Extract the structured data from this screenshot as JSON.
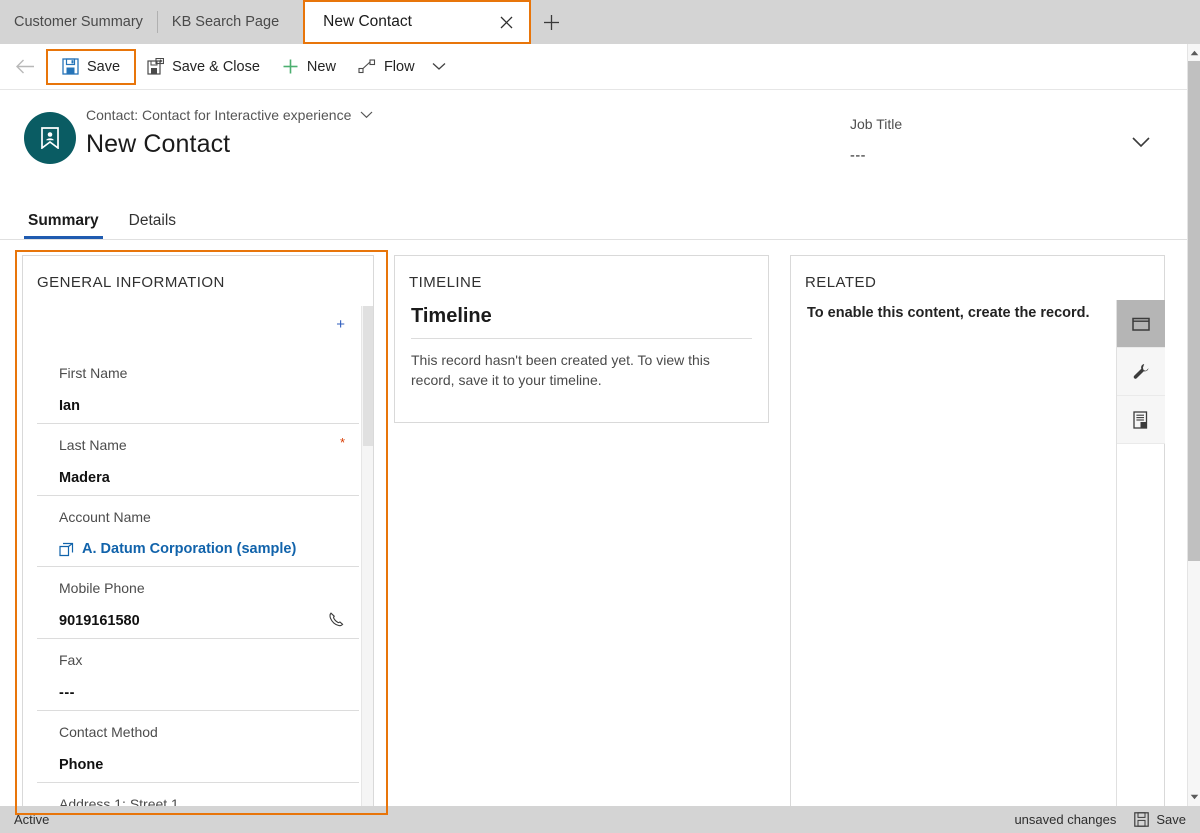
{
  "tabstrip": {
    "tabs": [
      {
        "label": "Customer Summary",
        "active": false
      },
      {
        "label": "KB Search Page",
        "active": false
      }
    ],
    "active_tab": {
      "label": "New Contact",
      "close_icon": "close-icon"
    },
    "new_tab_icon": "plus-icon",
    "highlight_color": "#e8750a"
  },
  "commandbar": {
    "back_icon": "back-arrow-icon",
    "commands": [
      {
        "label": "Save",
        "icon": "save-floppy-icon",
        "highlighted": true
      },
      {
        "label": "Save & Close",
        "icon": "save-and-close-icon",
        "highlighted": false
      },
      {
        "label": "New",
        "icon": "plus-icon",
        "highlighted": false
      },
      {
        "label": "Flow",
        "icon": "flow-icon",
        "highlighted": false
      }
    ],
    "overflow_icon": "chevron-down-icon"
  },
  "record_header": {
    "avatar_icon": "contact-card-icon",
    "avatar_color": "#0a5c63",
    "subtitle": "Contact: Contact for Interactive experience",
    "subtitle_chevron": "chevron-down-icon",
    "name": "New Contact",
    "header_field": {
      "label": "Job Title",
      "value": "---"
    },
    "expand_icon": "chevron-down-icon"
  },
  "form_tabs": [
    {
      "label": "Summary",
      "active": true
    },
    {
      "label": "Details",
      "active": false
    }
  ],
  "general_information": {
    "title": "GENERAL INFORMATION",
    "fields": [
      {
        "label": "First Name",
        "value": "Ian",
        "marker": "+",
        "marker_type": "recommended",
        "value_type": "text",
        "icon": null
      },
      {
        "label": "Last Name",
        "value": "Madera",
        "marker": "*",
        "marker_type": "required",
        "value_type": "text",
        "icon": null
      },
      {
        "label": "Account Name",
        "value": "A. Datum Corporation (sample)",
        "marker": null,
        "marker_type": null,
        "value_type": "lookup",
        "icon": "lookup-record-icon"
      },
      {
        "label": "Mobile Phone",
        "value": "9019161580",
        "marker": null,
        "marker_type": null,
        "value_type": "text",
        "icon": "phone-call-icon"
      },
      {
        "label": "Fax",
        "value": "---",
        "marker": null,
        "marker_type": null,
        "value_type": "text",
        "icon": null
      },
      {
        "label": "Contact Method",
        "value": "Phone",
        "marker": null,
        "marker_type": null,
        "value_type": "text",
        "icon": null
      },
      {
        "label": "Address 1: Street 1",
        "value": "",
        "marker": null,
        "marker_type": null,
        "value_type": "text",
        "icon": null
      }
    ]
  },
  "timeline": {
    "title": "TIMELINE",
    "heading": "Timeline",
    "message": "This record hasn't been created yet.  To view this record, save it to your timeline."
  },
  "related": {
    "title": "RELATED",
    "message": "To enable this content, create the record.",
    "rail": [
      {
        "icon": "window-panel-icon",
        "selected": true
      },
      {
        "icon": "wrench-icon",
        "selected": false
      },
      {
        "icon": "report-document-icon",
        "selected": false
      }
    ]
  },
  "statusbar": {
    "state": "Active",
    "unsaved": "unsaved changes",
    "save_label": "Save",
    "save_icon": "save-floppy-icon"
  },
  "scrollbar": {
    "up_icon": "scroll-up-arrow-icon",
    "down_icon": "scroll-down-arrow-icon"
  }
}
